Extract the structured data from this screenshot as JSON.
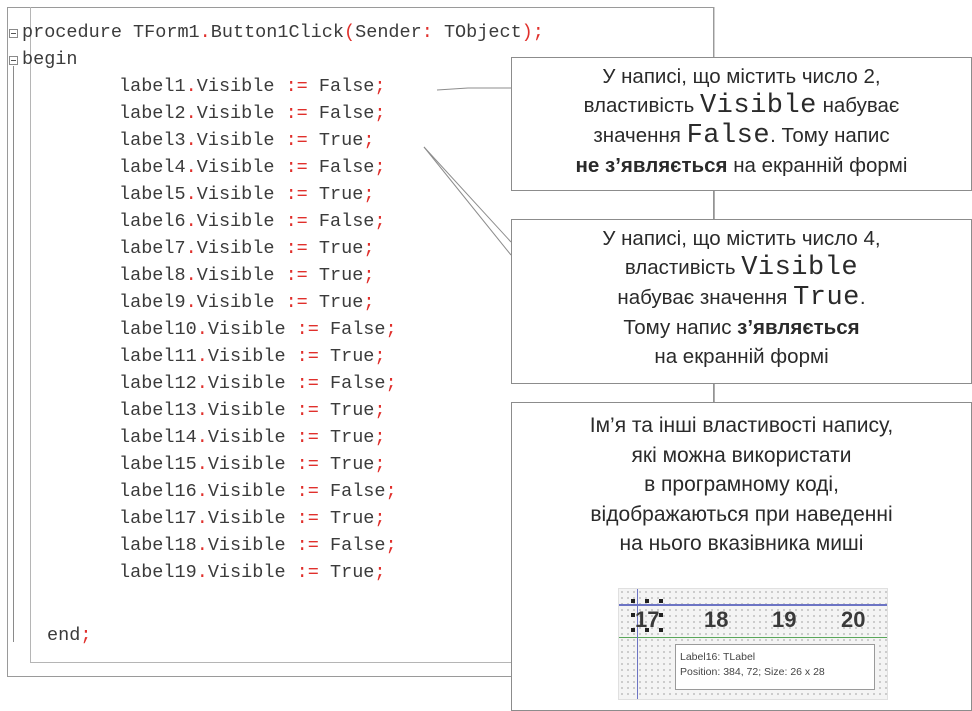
{
  "code": {
    "header": {
      "keyword": "procedure",
      "name": "TForm1",
      "dot": ".",
      "method": "Button1Click",
      "open_paren": "(",
      "param": "Sender",
      "colon": ":",
      "type": "TObject",
      "close": ");"
    },
    "begin": "begin",
    "end_word": "end",
    "end_semi": ";",
    "prop": "Visible",
    "assign": ":=",
    "semi": ";",
    "dot": ".",
    "lines": [
      {
        "label": "label1",
        "value": "False"
      },
      {
        "label": "label2",
        "value": "False"
      },
      {
        "label": "label3",
        "value": "True"
      },
      {
        "label": "label4",
        "value": "False"
      },
      {
        "label": "label5",
        "value": "True"
      },
      {
        "label": "label6",
        "value": "False"
      },
      {
        "label": "label7",
        "value": "True"
      },
      {
        "label": "label8",
        "value": "True"
      },
      {
        "label": "label9",
        "value": "True"
      },
      {
        "label": "label10",
        "value": "False"
      },
      {
        "label": "label11",
        "value": "True"
      },
      {
        "label": "label12",
        "value": "False"
      },
      {
        "label": "label13",
        "value": "True"
      },
      {
        "label": "label14",
        "value": "True"
      },
      {
        "label": "label15",
        "value": "True"
      },
      {
        "label": "label16",
        "value": "False"
      },
      {
        "label": "label17",
        "value": "True"
      },
      {
        "label": "label18",
        "value": "False"
      },
      {
        "label": "label19",
        "value": "True"
      }
    ]
  },
  "callout1": {
    "l1": "У написі, що містить число 2,",
    "l2a": "властивість ",
    "l2b": "Visible",
    "l2c": " набуває",
    "l3a": "значення ",
    "l3b": "False",
    "l3c": ". Тому напис",
    "l4a": "не з’являється",
    "l4b": " на екранній формі"
  },
  "callout2": {
    "l1": "У написі, що містить число 4,",
    "l2a": "властивість ",
    "l2b": "Visible",
    "l3a": "набуває значення ",
    "l3b": "True",
    "l3c": ".",
    "l4a": "Тому напис ",
    "l4b": "з’являється",
    "l5": "на екранній формі"
  },
  "callout3": {
    "lines": [
      "Ім’я та інші властивості напису,",
      "які можна використати",
      "в програмному коді,",
      "відображаються при наведенні",
      "на нього вказівника миші"
    ]
  },
  "mini_form": {
    "numbers": [
      "17",
      "18",
      "19",
      "20"
    ],
    "tooltip_l1": "Label16: TLabel",
    "tooltip_l2": "Position: 384, 72; Size: 26 x 28"
  }
}
